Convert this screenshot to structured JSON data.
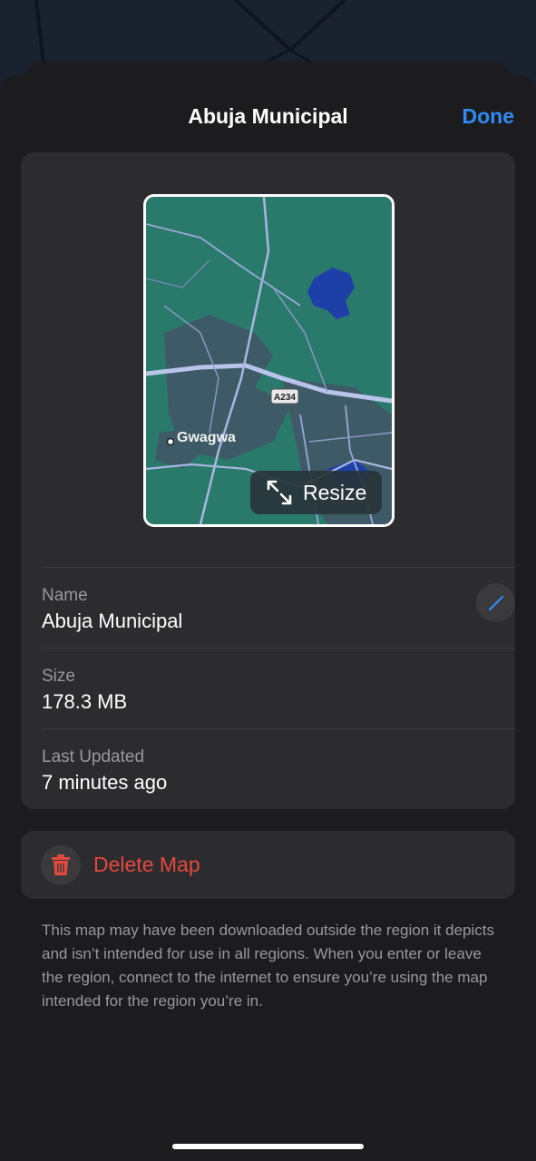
{
  "header": {
    "title": "Abuja Municipal",
    "done_label": "Done"
  },
  "map_preview": {
    "place_label": "Gwagwa",
    "road_shield": "A234",
    "resize_label": "Resize"
  },
  "details": [
    {
      "label": "Name",
      "value": "Abuja Municipal"
    },
    {
      "label": "Size",
      "value": "178.3 MB"
    },
    {
      "label": "Last Updated",
      "value": "7 minutes ago"
    }
  ],
  "delete": {
    "label": "Delete Map"
  },
  "footnote": "This map may have been downloaded outside the region it depicts and isn’t intended for use in all regions. When you enter or leave the region, connect to the internet to ensure you’re using the map intended for the region you’re in.",
  "colors": {
    "accent": "#2f8cf5",
    "destructive": "#e5483d",
    "map_green": "#2a7a6c",
    "water": "#1f3fa8"
  }
}
